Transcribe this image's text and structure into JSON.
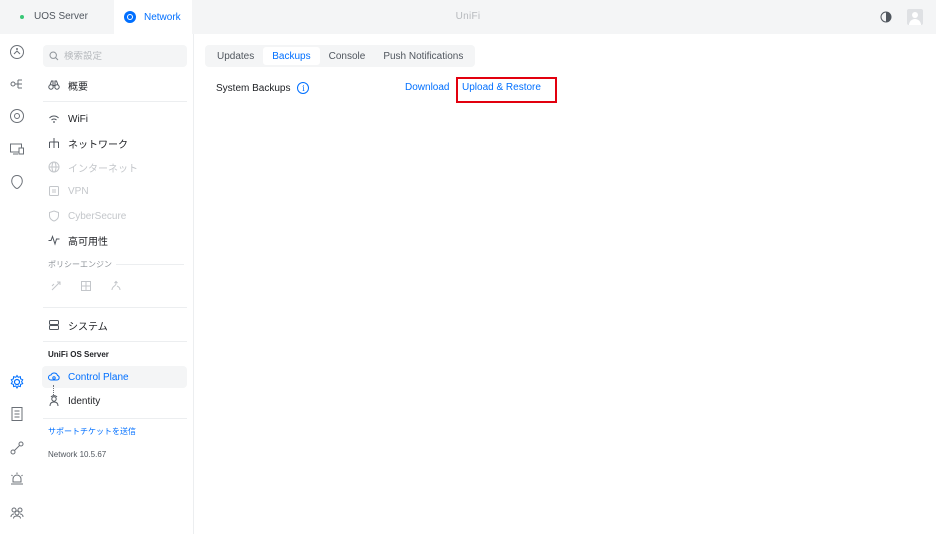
{
  "topbar": {
    "uos_tab": "UOS Server",
    "network_tab": "Network",
    "app_title": "UniFi",
    "icons": [
      "theme-toggle-icon",
      "user-avatar"
    ]
  },
  "rail": {
    "icons": [
      "dashboard-icon",
      "topology-icon",
      "devices-icon",
      "clients-icon",
      "insights-icon",
      "settings-icon",
      "logs-icon",
      "integrations-icon",
      "alarm-icon",
      "admins-icon"
    ]
  },
  "sidebar": {
    "search_placeholder": "検索設定",
    "overview": "概要",
    "wifi": "WiFi",
    "network": "ネットワーク",
    "internet": "インターネット",
    "vpn": "VPN",
    "cybersecure": "CyberSecure",
    "high_availability": "高可用性",
    "policy_engine": "ポリシーエンジン",
    "system": "システム",
    "unifi_os_server": "UniFi OS Server",
    "control_plane": "Control Plane",
    "identity": "Identity",
    "support_link": "サポートチケットを送信",
    "version": "Network 10.5.67"
  },
  "content": {
    "tabs": [
      "Updates",
      "Backups",
      "Console",
      "Push Notifications"
    ],
    "active_tab": "Backups",
    "system_backups_label": "System Backups",
    "info_symbol": "i",
    "download_label": "Download",
    "upload_restore_label": "Upload & Restore"
  },
  "colors": {
    "accent": "#006fff",
    "highlight_box": "#e2000e",
    "status_dot": "#38c776"
  }
}
